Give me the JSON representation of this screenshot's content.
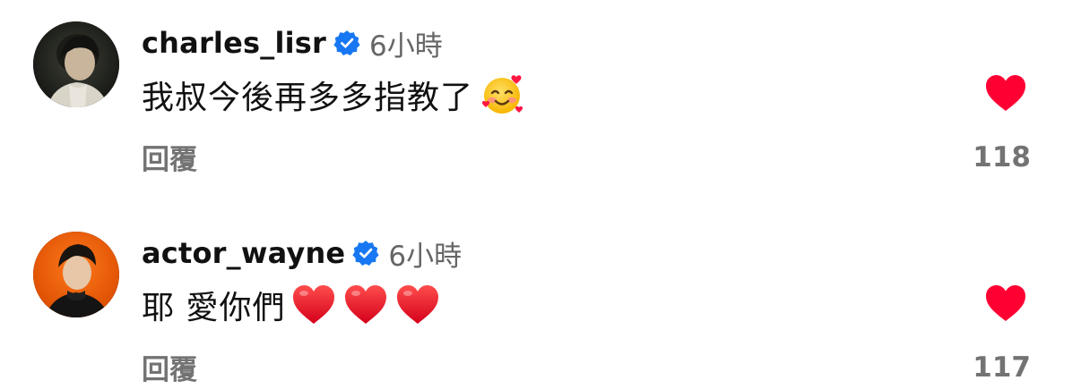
{
  "comments": [
    {
      "username": "charles_lisr",
      "verified": true,
      "time": "6小時",
      "text": "我叔今後再多多指教了",
      "emoji": "smiling-face-with-hearts",
      "reply_label": "回覆",
      "liked": true,
      "like_count": "118"
    },
    {
      "username": "actor_wayne",
      "verified": true,
      "time": "6小時",
      "text": "耶 愛你們",
      "emoji": "red-heart x3",
      "reply_label": "回覆",
      "liked": true,
      "like_count": "117"
    }
  ],
  "colors": {
    "verified_badge": "#1877F2",
    "like_heart": "#FF0033",
    "secondary_text": "#737373"
  }
}
